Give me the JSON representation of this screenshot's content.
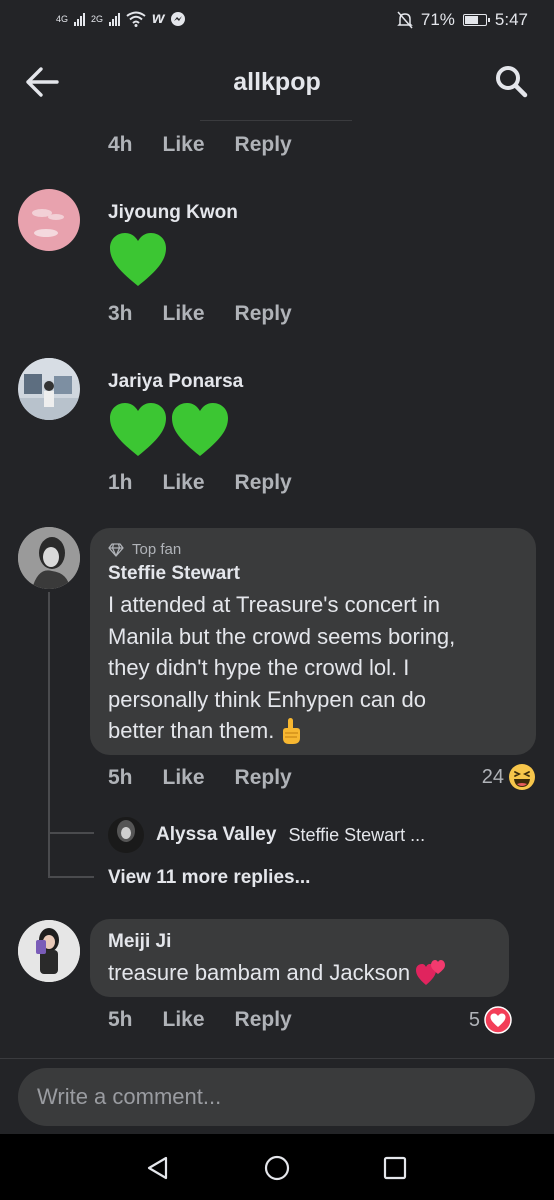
{
  "status_bar": {
    "net1": "4G",
    "net2": "2G",
    "battery_level": 0.71,
    "battery_text": "71%",
    "time": "5:47"
  },
  "header": {
    "title": "allkpop",
    "back_icon": "arrow-left-icon",
    "search_icon": "search-icon"
  },
  "actions": {
    "like": "Like",
    "reply": "Reply"
  },
  "comments": [
    {
      "time": "4h"
    },
    {
      "name": "Jiyoung Kwon",
      "time": "3h",
      "emoji": "green-heart",
      "emoji_count": 1
    },
    {
      "name": "Jariya Ponarsa",
      "time": "1h",
      "emoji": "green-heart",
      "emoji_count": 2
    },
    {
      "badge": "Top fan",
      "name": "Steffie Stewart",
      "lines": [
        "I attended at Treasure's concert in",
        "Manila but the crowd seems boring,",
        "they didn't hype the crowd lol. I",
        "personally think Enhypen can do",
        "better than them. "
      ],
      "time": "5h",
      "reaction_count": "24",
      "reaction_icon": "haha-icon",
      "reply_preview": {
        "name": "Alyssa Valley",
        "snippet": "Steffie Stewart ..."
      },
      "view_more": "View 11 more replies..."
    },
    {
      "name": "Meiji Ji",
      "text": "treasure bambam and Jackson ",
      "time": "5h",
      "reaction_count": "5",
      "reaction_icon": "love-icon"
    }
  ],
  "composer": {
    "placeholder": "Write a comment..."
  },
  "colors": {
    "background": "#232427",
    "bubble": "#3a3b3c",
    "meta": "#b0b3b8",
    "green_heart": "#3cc633"
  }
}
